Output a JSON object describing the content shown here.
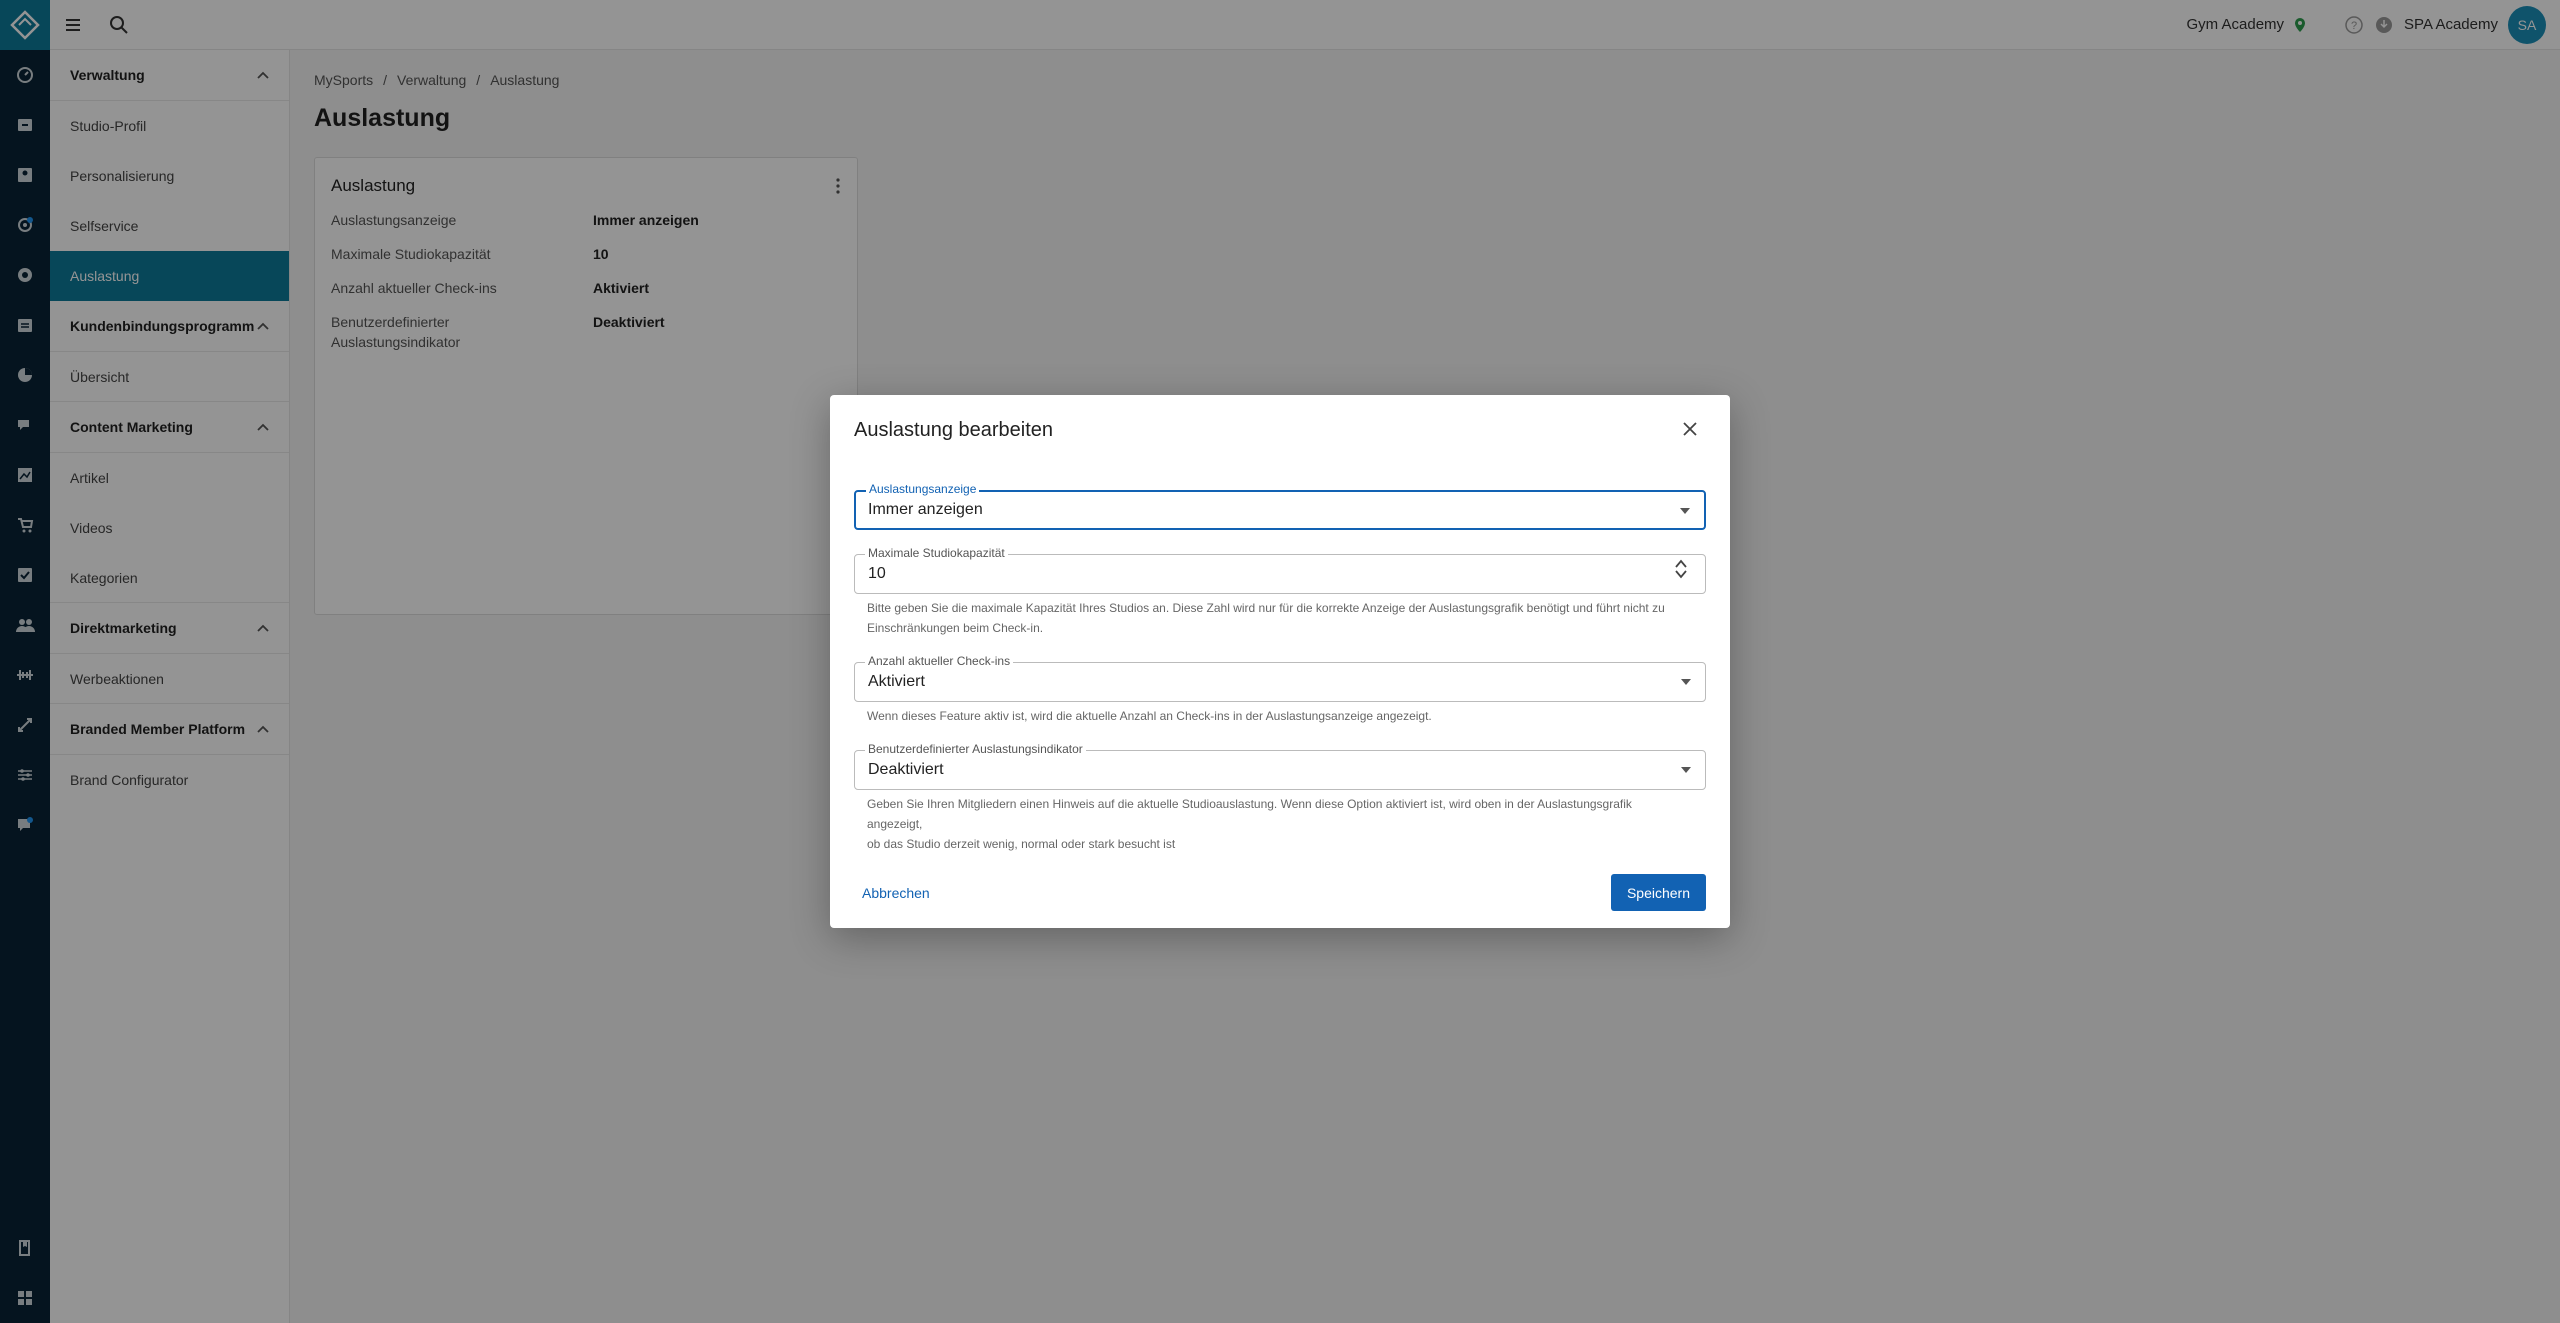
{
  "topbar": {
    "studio_name": "Gym Academy",
    "user_name": "SPA Academy",
    "avatar_initials": "SA"
  },
  "sidebar": {
    "groups": [
      {
        "label": "Verwaltung",
        "items": [
          "Studio-Profil",
          "Personalisierung",
          "Selfservice",
          "Auslastung"
        ]
      },
      {
        "label": "Kundenbindungsprogramm",
        "items": [
          "Übersicht"
        ]
      },
      {
        "label": "Content Marketing",
        "items": [
          "Artikel",
          "Videos",
          "Kategorien"
        ]
      },
      {
        "label": "Direktmarketing",
        "items": [
          "Werbeaktionen"
        ]
      },
      {
        "label": "Branded Member Platform",
        "items": [
          "Brand Configurator"
        ]
      }
    ],
    "active_item": "Auslastung"
  },
  "breadcrumb": {
    "items": [
      "MySports",
      "Verwaltung",
      "Auslastung"
    ],
    "sep": "/"
  },
  "page": {
    "title": "Auslastung"
  },
  "card": {
    "title": "Auslastung",
    "rows": [
      {
        "key": "Auslastungsanzeige",
        "value": "Immer anzeigen"
      },
      {
        "key": "Maximale Studiokapazität",
        "value": "10"
      },
      {
        "key": "Anzahl aktueller Check-ins",
        "value": "Aktiviert"
      },
      {
        "key_line1": "Benutzerdefinierter",
        "key_line2": "Auslastungsindikator",
        "value": "Deaktiviert"
      }
    ]
  },
  "modal": {
    "title": "Auslastung bearbeiten",
    "fields": {
      "display": {
        "label": "Auslastungsanzeige",
        "value": "Immer anzeigen"
      },
      "capacity": {
        "label": "Maximale Studiokapazität",
        "value": "10",
        "help_line1": "Bitte geben Sie die maximale Kapazität Ihres Studios an. Diese Zahl wird nur für die korrekte Anzeige der Auslastungsgrafik benötigt und führt nicht zu",
        "help_line2": "Einschränkungen beim Check-in."
      },
      "checkins": {
        "label": "Anzahl aktueller Check-ins",
        "value": "Aktiviert",
        "help": "Wenn dieses Feature aktiv ist, wird die aktuelle Anzahl an Check-ins in der Auslastungsanzeige angezeigt."
      },
      "indicator": {
        "label": "Benutzerdefinierter Auslastungsindikator",
        "value": "Deaktiviert",
        "help_line1": "Geben Sie Ihren Mitgliedern einen Hinweis auf die aktuelle Studioauslastung. Wenn diese Option aktiviert ist, wird oben in der Auslastungsgrafik angezeigt,",
        "help_line2": "ob das Studio derzeit wenig, normal oder stark besucht ist"
      }
    },
    "cancel_label": "Abbrechen",
    "save_label": "Speichern"
  },
  "colors": {
    "primary": "#1262b3",
    "accent": "#0d7a9a",
    "rail": "#0a2436"
  }
}
